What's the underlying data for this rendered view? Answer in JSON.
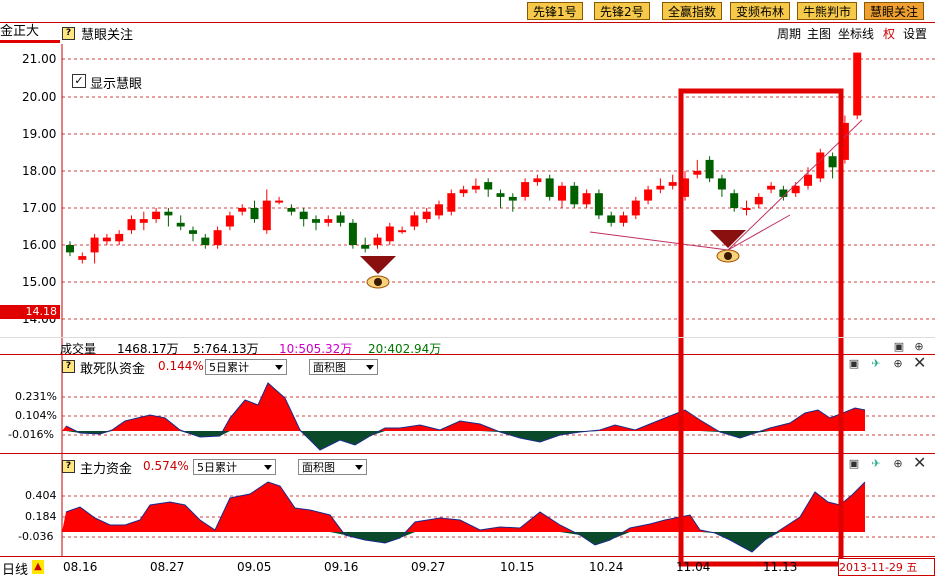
{
  "toolbar": {
    "buttons": [
      "先锋1号",
      "先锋2号",
      "全赢指数",
      "变频布林",
      "牛熊判市",
      "慧眼关注"
    ]
  },
  "header": {
    "stock_name": "金正大",
    "indicator_title": "慧眼关注",
    "menu": [
      "周期",
      "主图",
      "坐标线",
      "权",
      "设置"
    ]
  },
  "overlay": {
    "checkbox_label": "显示慧眼",
    "checked": true
  },
  "price_chart": {
    "y_ticks": [
      "21.00",
      "20.00",
      "19.00",
      "18.00",
      "17.00",
      "16.00",
      "15.00",
      "14.00"
    ],
    "current_price_marker": "14.18"
  },
  "volume_bar": {
    "label": "成交量",
    "total": "1468.17万",
    "ma5": "5:764.13万",
    "ma10": "10:505.32万",
    "ma20": "20:402.94万"
  },
  "panel1": {
    "title": "敢死队资金",
    "value": "0.144%",
    "period_select": "5日累计",
    "type_select": "面积图",
    "y_ticks": [
      "0.231%",
      "0.104%",
      "-0.016%"
    ]
  },
  "panel2": {
    "title": "主力资金",
    "value": "0.574%",
    "period_select": "5日累计",
    "type_select": "面积图",
    "y_ticks": [
      "0.404",
      "0.184",
      "-0.036"
    ]
  },
  "bottom": {
    "period_label": "日线",
    "dates": [
      "08.16",
      "08.27",
      "09.05",
      "09.16",
      "09.27",
      "10.15",
      "10.24",
      "11.04",
      "11.13"
    ],
    "current_date": "2013-11-29 五"
  },
  "colors": {
    "up": "#ff0000",
    "down": "#006000",
    "area_neg": "#0a4a2a",
    "accent": "#e00000"
  }
}
